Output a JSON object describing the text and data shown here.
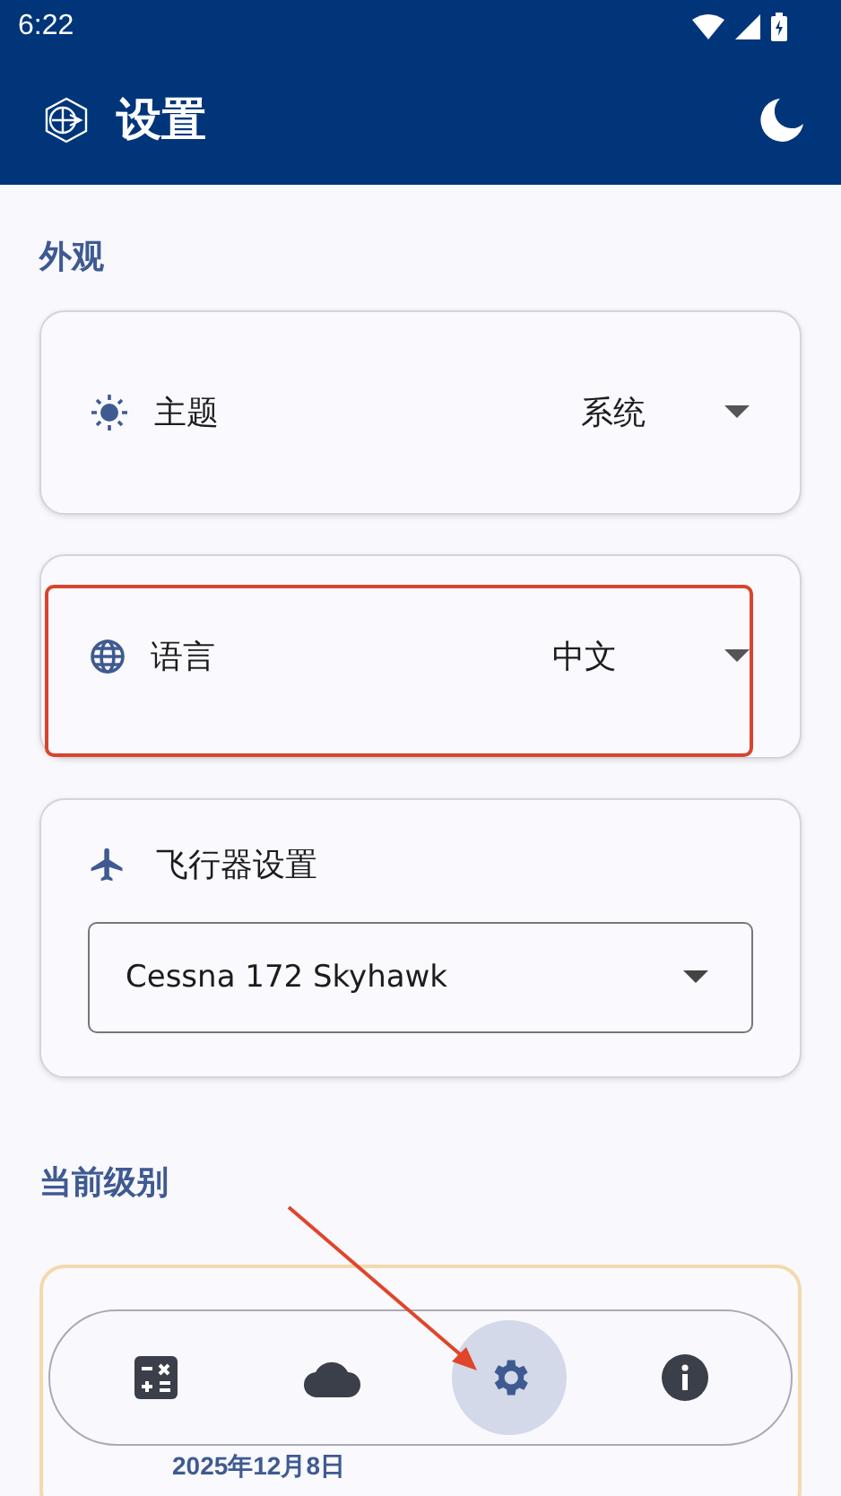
{
  "status_bar": {
    "time": "6:22"
  },
  "app_bar": {
    "title": "设置"
  },
  "sections": [
    {
      "title": "外观"
    }
  ],
  "theme_setting": {
    "label": "主题",
    "value": "系统"
  },
  "language_setting": {
    "label": "语言",
    "value": "中文"
  },
  "aircraft_setting": {
    "label": "飞行器设置",
    "value": "Cessna 172 Skyhawk"
  },
  "level_section": {
    "title": "当前级别",
    "date": "2025年12月8日"
  },
  "bottom_nav": [
    {
      "kind": "calculator",
      "selected": false
    },
    {
      "kind": "cloud",
      "selected": false
    },
    {
      "kind": "settings",
      "selected": true
    },
    {
      "kind": "info",
      "selected": false
    }
  ]
}
